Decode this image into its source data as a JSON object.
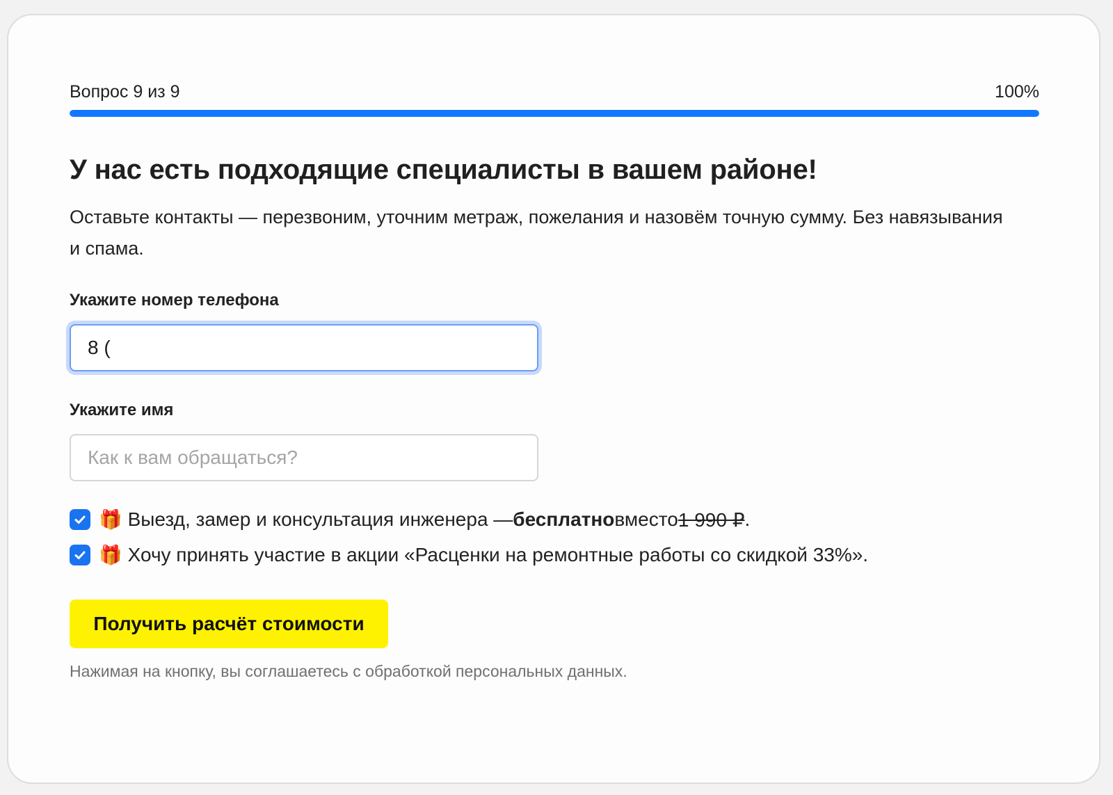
{
  "progress": {
    "question_label": "Вопрос 9 из 9",
    "percent_label": "100%",
    "fraction": 1.0
  },
  "heading": {
    "title": "У нас есть подходящие специалисты в вашем районе!",
    "subtitle": "Оставьте контакты — перезвоним, уточним метраж, пожелания и назовём точную сумму. Без навязывания и спама."
  },
  "form": {
    "phone": {
      "label": "Укажите номер телефона",
      "value": "8 ("
    },
    "name": {
      "label": "Укажите имя",
      "value": "",
      "placeholder": "Как к вам обращаться?"
    },
    "checkboxes": [
      {
        "checked": true,
        "icon": "gift-icon",
        "text_before": "Выезд, замер и консультация инженера — ",
        "text_bold": "бесплатно",
        "text_middle": " вместо ",
        "text_strike": "1 990 ₽",
        "text_after": "."
      },
      {
        "checked": true,
        "icon": "gift-icon",
        "text": "Хочу принять участие в акции «Расценки на ремонтные работы со скидкой 33%»."
      }
    ],
    "submit_label": "Получить расчёт стоимости",
    "consent_text": "Нажимая на кнопку, вы соглашаетесь с обработкой персональных данных."
  },
  "colors": {
    "accent": "#1177ff",
    "checkbox": "#1a73f0",
    "button": "#fff200"
  }
}
